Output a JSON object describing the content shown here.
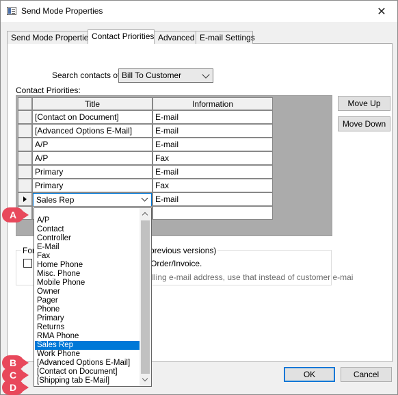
{
  "window": {
    "title": "Send Mode Properties"
  },
  "tabs": [
    {
      "label": "Send Mode Properties"
    },
    {
      "label": "Contact Priorities"
    },
    {
      "label": "Advanced"
    },
    {
      "label": "E-mail Settings"
    }
  ],
  "search": {
    "label": "Search contacts of:",
    "value": "Bill To Customer"
  },
  "priorities": {
    "label": "Contact Priorities:",
    "columns": {
      "title": "Title",
      "information": "Information"
    },
    "rows": [
      {
        "title": "[Contact on Document]",
        "info": "E-mail"
      },
      {
        "title": "[Advanced Options E-Mail]",
        "info": "E-mail"
      },
      {
        "title": "A/P",
        "info": "E-mail"
      },
      {
        "title": "A/P",
        "info": "Fax"
      },
      {
        "title": "Primary",
        "info": "E-mail"
      },
      {
        "title": "Primary",
        "info": "Fax"
      },
      {
        "title": "Sales Rep",
        "info": "E-mail"
      }
    ]
  },
  "buttons": {
    "move_up": "Move Up",
    "move_down": "Move Down",
    "ok": "OK",
    "cancel": "Cancel"
  },
  "group": {
    "label_start": "For",
    "label_end": "previous versions)",
    "option_text": "Order/Invoice.",
    "desc_text": "billing e-mail address, use that instead of customer e-mai"
  },
  "dropdown": {
    "items": [
      "A/P",
      "Contact",
      "Controller",
      "E-Mail",
      "Fax",
      "Home Phone",
      "Misc. Phone",
      "Mobile Phone",
      "Owner",
      "Pager",
      "Phone",
      "Primary",
      "Returns",
      "RMA Phone",
      "Sales Rep",
      "Work Phone",
      "[Advanced Options E-Mail]",
      "[Contact on Document]",
      "[Shipping tab E-Mail]"
    ],
    "selected": "Sales Rep"
  },
  "annotations": [
    "A",
    "B",
    "C",
    "D"
  ],
  "colors": {
    "accent": "#0078d7",
    "badge": "#e8485b"
  }
}
